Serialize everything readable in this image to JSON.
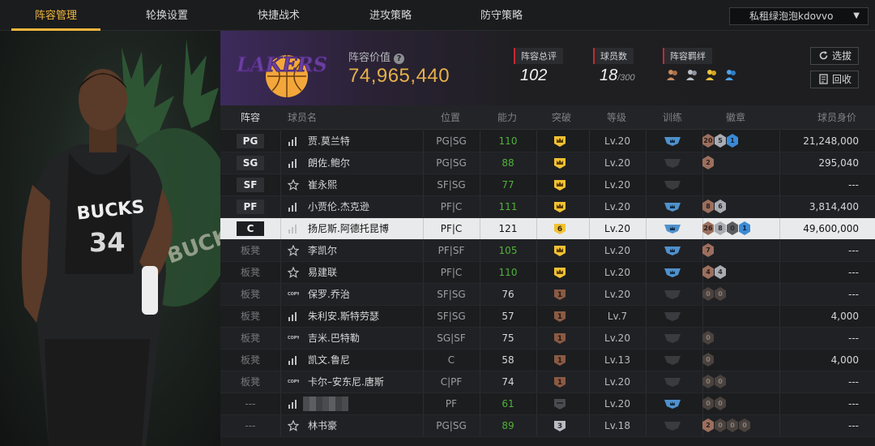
{
  "tabs": [
    {
      "label": "阵容管理",
      "active": true
    },
    {
      "label": "轮换设置",
      "active": false
    },
    {
      "label": "快捷战术",
      "active": false
    },
    {
      "label": "进攻策略",
      "active": false
    },
    {
      "label": "防守策略",
      "active": false
    }
  ],
  "account": {
    "name": "私租绿泡泡kdovvo",
    "caret": "▼"
  },
  "team": {
    "logo_text": "LAKERS",
    "value_label": "阵容价值",
    "value": "74,965,440",
    "stats": [
      {
        "label": "阵容总评",
        "value": "102",
        "suffix": ""
      },
      {
        "label": "球员数",
        "value": "18",
        "suffix": "/300"
      },
      {
        "label": "阵容羁绊",
        "value": "",
        "suffix": ""
      }
    ],
    "buttons": {
      "draft": "选拔",
      "recycle": "回收"
    }
  },
  "table": {
    "headers": [
      "阵容",
      "球员名",
      "位置",
      "能力",
      "突破",
      "等级",
      "训练",
      "徽章",
      "球员身价"
    ],
    "rows": [
      {
        "slot": "PG",
        "starter": true,
        "icon": "bars-icon",
        "name": "贾.莫兰特",
        "pos": "PG|SG",
        "ability": "110",
        "green": true,
        "breakthrough": "crown-gold",
        "level": "Lv.20",
        "train": "blue",
        "badges": [
          [
            "bronze",
            "20"
          ],
          [
            "silver",
            "5"
          ],
          [
            "blue",
            "1"
          ]
        ],
        "price": "21,248,000"
      },
      {
        "slot": "SG",
        "starter": true,
        "icon": "bars-icon",
        "name": "朗佐.鲍尔",
        "pos": "PG|SG",
        "ability": "88",
        "green": true,
        "breakthrough": "crown-gold",
        "level": "Lv.20",
        "train": "gray",
        "badges": [
          [
            "bronze",
            "2"
          ]
        ],
        "price": "295,040"
      },
      {
        "slot": "SF",
        "starter": true,
        "icon": "star-icon",
        "name": "崔永熙",
        "pos": "SF|SG",
        "ability": "77",
        "green": true,
        "breakthrough": "crown-gold",
        "level": "Lv.20",
        "train": "gray",
        "badges": [],
        "price": "---"
      },
      {
        "slot": "PF",
        "starter": true,
        "icon": "bars-icon",
        "name": "小贾伦.杰克逊",
        "pos": "PF|C",
        "ability": "111",
        "green": true,
        "breakthrough": "crown-gold",
        "level": "Lv.20",
        "train": "blue",
        "badges": [
          [
            "bronze",
            "8"
          ],
          [
            "silver",
            "6"
          ]
        ],
        "price": "3,814,400"
      },
      {
        "slot": "C",
        "starter": true,
        "selected": true,
        "icon": "bars-icon",
        "name": "扬尼斯.阿德托昆博",
        "pos": "PF|C",
        "ability": "121",
        "green": false,
        "breakthrough": "six",
        "level": "Lv.20",
        "train": "blue",
        "badges": [
          [
            "bronze",
            "26"
          ],
          [
            "silver",
            "8"
          ],
          [
            "gray",
            "0"
          ],
          [
            "blue",
            "1"
          ]
        ],
        "price": "49,600,000"
      },
      {
        "slot": "板凳",
        "starter": false,
        "icon": "star-icon",
        "name": "李凯尔",
        "pos": "PF|SF",
        "ability": "105",
        "green": true,
        "breakthrough": "crown-gold",
        "level": "Lv.20",
        "train": "blue",
        "badges": [
          [
            "bronze",
            "7"
          ]
        ],
        "price": "---"
      },
      {
        "slot": "板凳",
        "starter": false,
        "icon": "star-icon",
        "name": "易建联",
        "pos": "PF|C",
        "ability": "110",
        "green": true,
        "breakthrough": "crown-gold",
        "level": "Lv.20",
        "train": "blue",
        "badges": [
          [
            "bronze",
            "4"
          ],
          [
            "silver",
            "4"
          ]
        ],
        "price": "---"
      },
      {
        "slot": "板凳",
        "starter": false,
        "icon": "copy-icon",
        "name": "保罗.乔治",
        "pos": "SF|SG",
        "ability": "76",
        "green": false,
        "breakthrough": "one",
        "level": "Lv.20",
        "train": "gray",
        "badges": [
          [
            "dark",
            "0"
          ],
          [
            "dark",
            "0"
          ]
        ],
        "price": "---"
      },
      {
        "slot": "板凳",
        "starter": false,
        "icon": "bars-icon",
        "name": "朱利安.斯特劳瑟",
        "pos": "SF|SG",
        "ability": "57",
        "green": false,
        "breakthrough": "one",
        "level": "Lv.7",
        "train": "gray",
        "badges": [],
        "price": "4,000"
      },
      {
        "slot": "板凳",
        "starter": false,
        "icon": "copy-icon",
        "name": "吉米.巴特勒",
        "pos": "SG|SF",
        "ability": "75",
        "green": false,
        "breakthrough": "one",
        "level": "Lv.20",
        "train": "gray",
        "badges": [
          [
            "dark",
            "0"
          ]
        ],
        "price": "---"
      },
      {
        "slot": "板凳",
        "starter": false,
        "icon": "bars-icon",
        "name": "凯文.鲁尼",
        "pos": "C",
        "ability": "58",
        "green": false,
        "breakthrough": "one",
        "level": "Lv.13",
        "train": "gray",
        "badges": [
          [
            "dark",
            "0"
          ]
        ],
        "price": "4,000"
      },
      {
        "slot": "板凳",
        "starter": false,
        "icon": "copy-icon",
        "name": "卡尔–安东尼.唐斯",
        "pos": "C|PF",
        "ability": "74",
        "green": false,
        "breakthrough": "one",
        "level": "Lv.20",
        "train": "gray",
        "badges": [
          [
            "dark",
            "0"
          ],
          [
            "dark",
            "0"
          ]
        ],
        "price": "---"
      },
      {
        "slot": "---",
        "starter": false,
        "blurred": true,
        "icon": "bars-icon",
        "name": "",
        "pos": "PF",
        "ability": "61",
        "green": true,
        "breakthrough": "gray",
        "level": "Lv.20",
        "train": "blue",
        "badges": [
          [
            "dark",
            "0"
          ],
          [
            "dark",
            "0"
          ]
        ],
        "price": "---"
      },
      {
        "slot": "---",
        "starter": false,
        "icon": "star-icon",
        "name": "林书豪",
        "pos": "PG|SG",
        "ability": "89",
        "green": true,
        "breakthrough": "three",
        "level": "Lv.18",
        "train": "gray",
        "badges": [
          [
            "bronze",
            "2"
          ],
          [
            "dark",
            "0"
          ],
          [
            "dark",
            "0"
          ],
          [
            "dark",
            "0"
          ]
        ],
        "price": "---"
      }
    ]
  },
  "colors": {
    "accent": "#f0b63c",
    "green": "#4fb23a",
    "red": "#c8282f"
  }
}
